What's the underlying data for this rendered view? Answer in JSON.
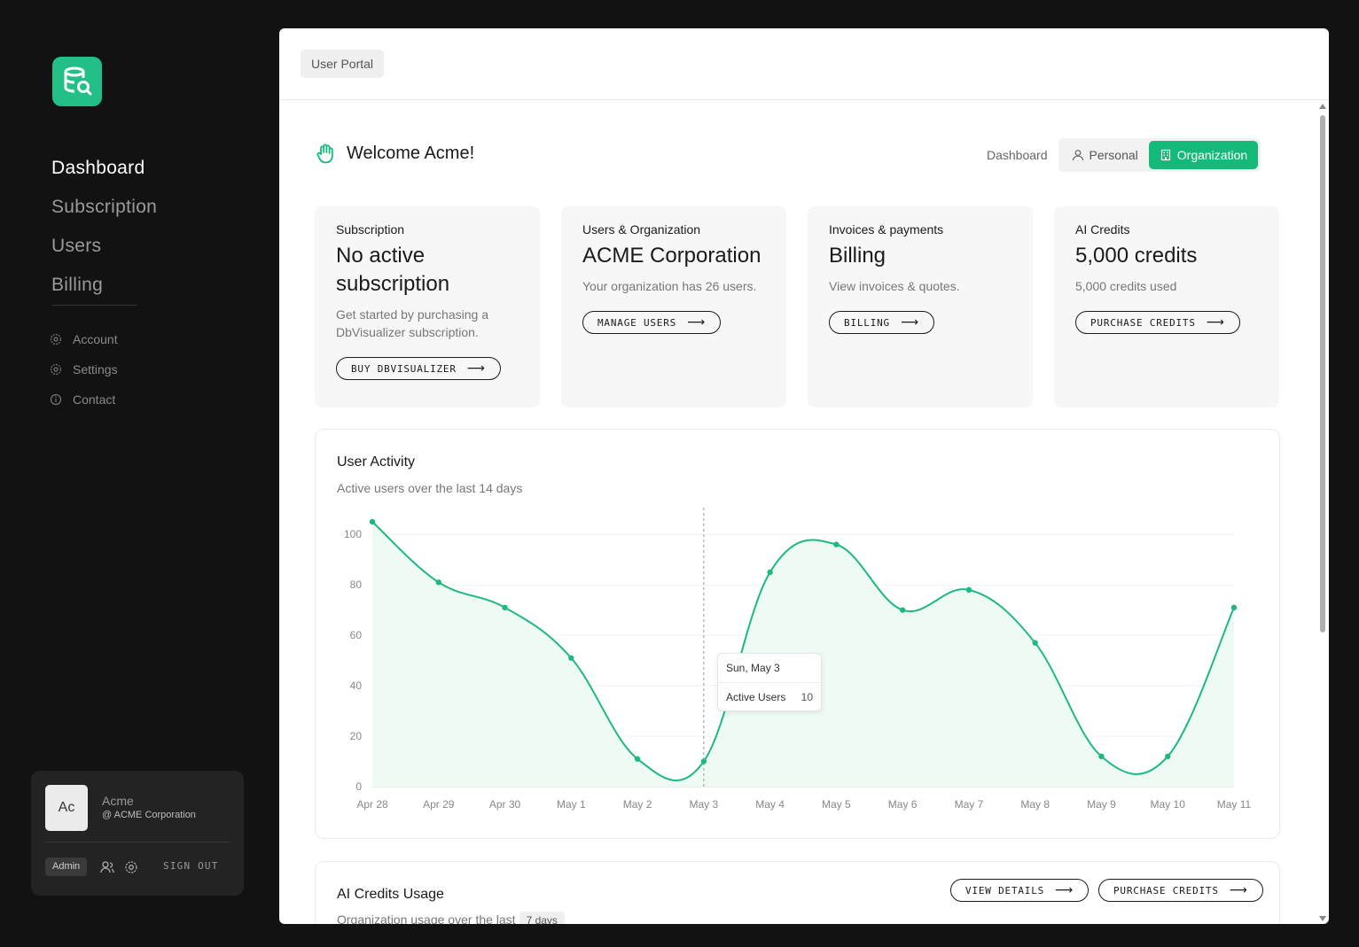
{
  "sidebar": {
    "nav_main": [
      "Dashboard",
      "Subscription",
      "Users",
      "Billing"
    ],
    "nav_sub": [
      {
        "label": "Account",
        "icon": "gear-icon"
      },
      {
        "label": "Settings",
        "icon": "gear-icon"
      },
      {
        "label": "Contact",
        "icon": "info-icon"
      }
    ],
    "user": {
      "initials": "Ac",
      "name": "Acme",
      "org": "@ ACME Corporation",
      "role": "Admin",
      "signout": "SIGN OUT"
    }
  },
  "header": {
    "breadcrumb": "User Portal"
  },
  "welcome": {
    "title": "Welcome Acme!",
    "toggle_label": "Dashboard",
    "toggle_options": [
      "Personal",
      "Organization"
    ],
    "active_option": "Organization"
  },
  "cards": [
    {
      "kicker": "Subscription",
      "title": "No active subscription",
      "desc": "Get started by purchasing a DbVisualizer subscription.",
      "button": "BUY DBVISUALIZER"
    },
    {
      "kicker": "Users & Organization",
      "title": "ACME Corporation",
      "desc": "Your organization has 26 users.",
      "button": "MANAGE USERS"
    },
    {
      "kicker": "Invoices & payments",
      "title": "Billing",
      "desc": "View invoices & quotes.",
      "button": "BILLING"
    },
    {
      "kicker": "AI Credits",
      "title": "5,000 credits",
      "desc": "5,000 credits used",
      "button": "PURCHASE CREDITS"
    }
  ],
  "activity": {
    "title": "User Activity",
    "subtitle": "Active users over the last 14 days",
    "tooltip": {
      "date": "Sun, May 3",
      "label": "Active Users",
      "value": "10"
    }
  },
  "credits_panel": {
    "title": "AI Credits Usage",
    "subtitle": "Organization usage over the last",
    "badge": "7 days",
    "buttons": [
      "VIEW DETAILS",
      "PURCHASE CREDITS"
    ]
  },
  "colors": {
    "accent": "#15b97a",
    "line": "#1fb980",
    "fill": "#eefbf5"
  },
  "chart_data": {
    "type": "area",
    "categories": [
      "Apr 28",
      "Apr 29",
      "Apr 30",
      "May 1",
      "May 2",
      "May 3",
      "May 4",
      "May 5",
      "May 6",
      "May 7",
      "May 8",
      "May 9",
      "May 10",
      "May 11"
    ],
    "series": [
      {
        "values": [
          105,
          81,
          71,
          51,
          11,
          10,
          85,
          96,
          70,
          78,
          57,
          12,
          12,
          71
        ]
      }
    ],
    "yticks": [
      0,
      20,
      40,
      60,
      80,
      100
    ],
    "ylim": [
      0,
      105
    ],
    "grid": true,
    "highlight_index": 5
  }
}
